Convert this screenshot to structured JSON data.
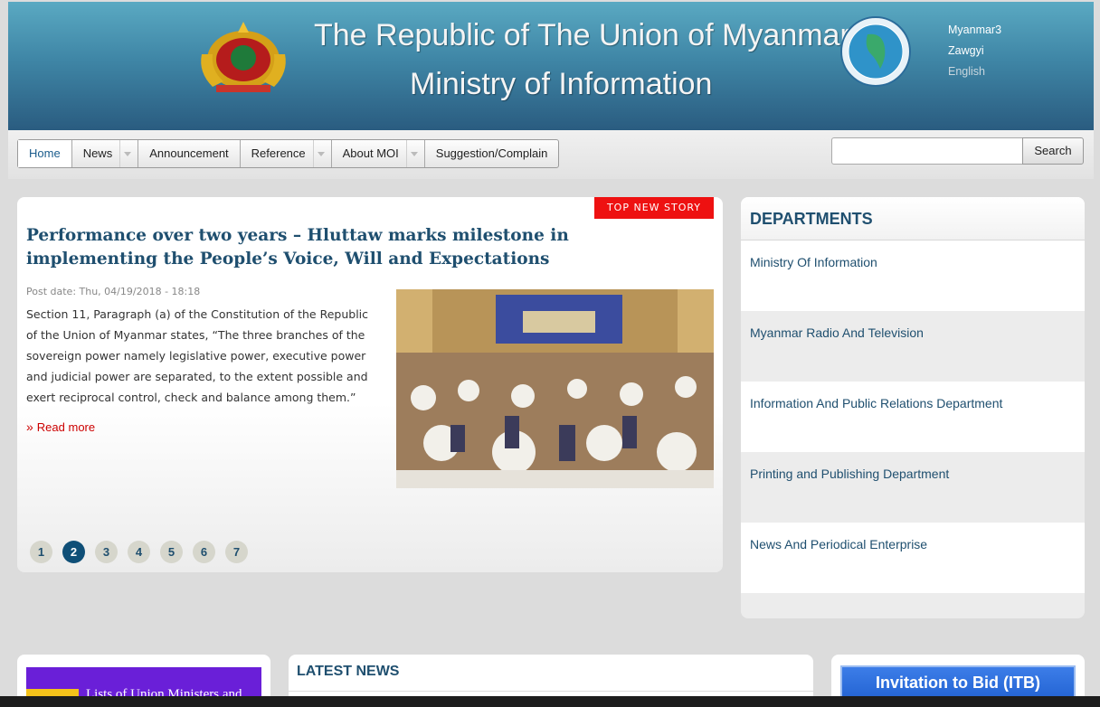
{
  "header": {
    "title_line1": "The Republic of The Union of Myanmar",
    "title_line2": "Ministry of Information",
    "emblem_icon": "state-emblem-icon",
    "seal_icon": "ministry-seal-icon",
    "languages": [
      "Myanmar3",
      "Zawgyi",
      "English"
    ]
  },
  "nav": {
    "items": [
      {
        "label": "Home"
      },
      {
        "label": "News"
      },
      {
        "label": "Announcement"
      },
      {
        "label": "Reference"
      },
      {
        "label": "About MOI"
      },
      {
        "label": "Suggestion/Complain"
      }
    ],
    "search_placeholder": "",
    "search_button": "Search"
  },
  "feature": {
    "badge": "TOP NEW STORY",
    "title": "Performance over two years – Hluttaw marks milestone in implementing the People’s Voice, Will and Expectations",
    "post_date": "Post date: Thu, 04/19/2018 - 18:18",
    "text": "Section 11, Paragraph (a) of the Constitution of the Republic of the Union of Myanmar states, “The three branches of the sovereign power namely legislative power, executive power and judicial power are separated, to the extent possible and exert reciprocal control, check and balance among them.”",
    "read_more": "Read more",
    "pages": [
      "1",
      "2",
      "3",
      "4",
      "5",
      "6",
      "7"
    ],
    "active_page": "2"
  },
  "departments": {
    "heading": "DEPARTMENTS",
    "items": [
      "Ministry Of Information",
      "Myanmar Radio And Television",
      "Information And Public Relations Department",
      "Printing and Publishing Department",
      "News And Periodical Enterprise"
    ]
  },
  "bottom": {
    "ministers_banner": "Lists of Union Ministers and",
    "latest_news": "LATEST NEWS",
    "invitation": "Invitation to Bid (ITB)"
  },
  "colors": {
    "accent": "#1f4f6f",
    "badge": "#ee1111",
    "read_more": "#cc0000",
    "active_page": "#0f4f77"
  }
}
